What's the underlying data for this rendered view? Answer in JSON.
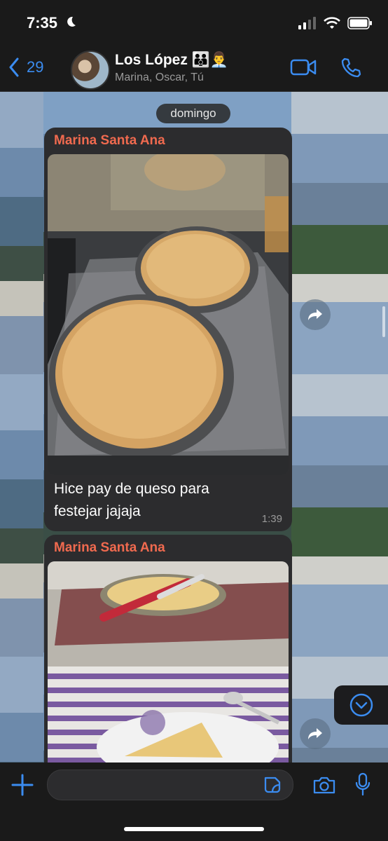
{
  "status": {
    "time": "7:35"
  },
  "header": {
    "back_count": "29",
    "title": "Los López",
    "title_emoji": "👨‍👨‍👦👨‍💼",
    "subtitle": "Marina, Oscar, Tú"
  },
  "chat": {
    "date_label": "domingo",
    "messages": [
      {
        "sender": "Marina Santa Ana",
        "caption_line1": "Hice pay de queso para",
        "caption_line2": "festejar jajaja",
        "time": "1:39"
      },
      {
        "sender": "Marina Santa Ana"
      }
    ]
  },
  "composer": {
    "placeholder": ""
  },
  "colors": {
    "accent": "#3b8cf0",
    "sender": "#f06a4f",
    "bubble": "#2c2c2e"
  }
}
